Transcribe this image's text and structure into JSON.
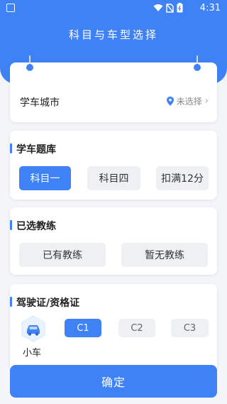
{
  "status_bar": {
    "time": "4:31"
  },
  "page": {
    "title": "科目与车型选择"
  },
  "city": {
    "label": "学车城市",
    "value": "未选择"
  },
  "question_bank": {
    "title": "学车题库",
    "options": [
      {
        "label": "科目一",
        "selected": true
      },
      {
        "label": "科目四",
        "selected": false
      },
      {
        "label": "扣满12分",
        "selected": false
      }
    ]
  },
  "coach": {
    "title": "已选教练",
    "options": [
      {
        "label": "已有教练",
        "selected": false
      },
      {
        "label": "暂无教练",
        "selected": false
      }
    ]
  },
  "license": {
    "title": "驾驶证/资格证",
    "vehicle_label": "小车",
    "options": [
      {
        "label": "C1",
        "selected": true
      },
      {
        "label": "C2",
        "selected": false
      },
      {
        "label": "C3",
        "selected": false
      }
    ]
  },
  "confirm_label": "确定",
  "colors": {
    "accent": "#3f82f6",
    "background": "#f4f5f8",
    "option_bg": "#eef0f4"
  }
}
